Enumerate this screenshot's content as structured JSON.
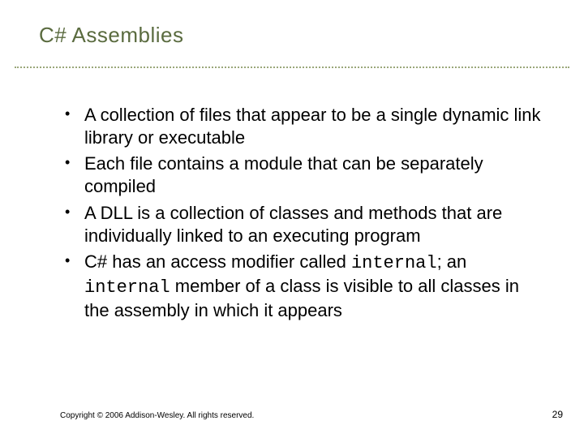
{
  "title": "C# Assemblies",
  "bullets": {
    "b1": "A collection of files that appear to be a single dynamic link library or executable",
    "b2": "Each file contains a module that can be separately compiled",
    "b3": "A DLL is a collection of classes and methods that are individually linked to an executing program",
    "b4_part1": "C# has an access modifier called ",
    "b4_code1": "internal",
    "b4_part2": "; an ",
    "b4_code2": "internal",
    "b4_part3": " member of a class is visible to all classes in the assembly in which it appears"
  },
  "footer": {
    "copyright": "Copyright © 2006 Addison-Wesley. All rights reserved.",
    "page": "29"
  }
}
